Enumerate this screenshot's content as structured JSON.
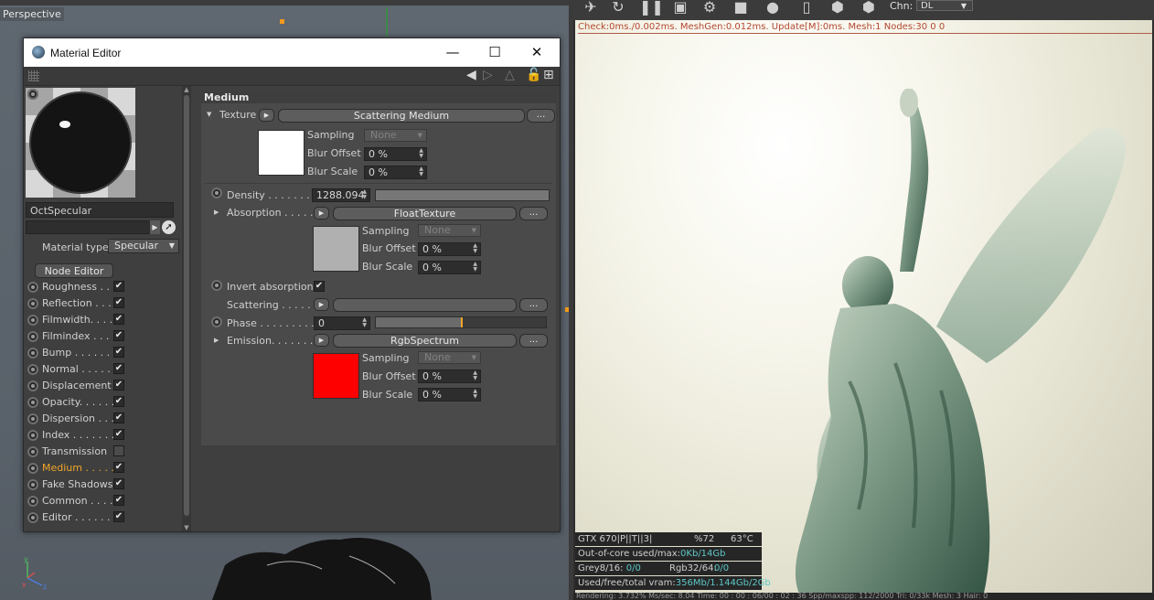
{
  "viewport": {
    "label": "Perspective"
  },
  "render": {
    "chn_label": "Chn:",
    "chn_value": "DL",
    "status_line": "Check:0ms./0.002ms. MeshGen:0.012ms. Update[M]:0ms. Mesh:1 Nodes:30  0 0",
    "stats": {
      "gpu": "GTX 670|P||T||3|",
      "gpu_util": "%72",
      "gpu_temp": "63°C",
      "ooc_label": "Out-of-core used/max:",
      "ooc_value": "0Kb/14Gb",
      "grey_label": "Grey8/16:",
      "grey_value": "0/0",
      "rgb_label": "Rgb32/64:",
      "rgb_value": "0/0",
      "vram_label": "Used/free/total vram:",
      "vram_value": "356Mb/1.144Gb/2Gb"
    },
    "bottom_line": "Rendering: 3.732%   Ms/sec: 8.04   Time: 00 : 00 : 06/00 : 02 : 36   Spp/maxspp: 112/2000   Tri: 0/33k   Mesh: 3   Hair: 0"
  },
  "material_editor": {
    "title": "Material Editor",
    "material_name": "OctSpecular",
    "material_type_label": "Material type",
    "material_type_value": "Specular",
    "node_editor_label": "Node Editor",
    "channels": [
      {
        "label": "Roughness . .",
        "checked": true
      },
      {
        "label": "Reflection . . .",
        "checked": true
      },
      {
        "label": "Filmwidth. . . .",
        "checked": true
      },
      {
        "label": "Filmindex . . . .",
        "checked": true
      },
      {
        "label": "Bump . . . . . . .",
        "checked": true
      },
      {
        "label": "Normal . . . . . .",
        "checked": true
      },
      {
        "label": "Displacement",
        "checked": true
      },
      {
        "label": "Opacity. . . . . .",
        "checked": true
      },
      {
        "label": "Dispersion . . .",
        "checked": true
      },
      {
        "label": "Index . . . . . . .",
        "checked": true
      },
      {
        "label": "Transmission",
        "checked": false
      },
      {
        "label": "Medium . . . . .",
        "checked": true,
        "active": true
      },
      {
        "label": "Fake Shadows",
        "checked": true
      },
      {
        "label": "Common . . . .",
        "checked": true
      },
      {
        "label": "Editor . . . . . . .",
        "checked": true
      }
    ],
    "panel": {
      "header": "Medium",
      "texture_label": "Texture",
      "texture_button": "Scattering Medium",
      "dots": "...",
      "sampling_label": "Sampling",
      "sampling_value": "None",
      "blur_offset_label": "Blur Offset",
      "blur_scale_label": "Blur Scale",
      "pct_value": "0 %",
      "density_label": "Density . . . . . . . . .",
      "density_value": "1288.094",
      "absorption_label": "Absorption . . . . .",
      "absorption_button": "FloatTexture",
      "invert_absorption_label": "Invert absorption",
      "invert_absorption_checked": true,
      "scattering_label": "Scattering . . . . . .",
      "phase_label": "Phase . . . . . . . . . .",
      "phase_value": "0",
      "phase_slider_position": 0.5,
      "emission_label": "Emission. . . . . . . . .",
      "emission_button": "RgbSpectrum",
      "colors": {
        "texture_swatch": "#ffffff",
        "absorption_swatch": "#b0b0b0",
        "emission_swatch": "#ff0000",
        "active_channel": "#f0a52a"
      }
    }
  }
}
